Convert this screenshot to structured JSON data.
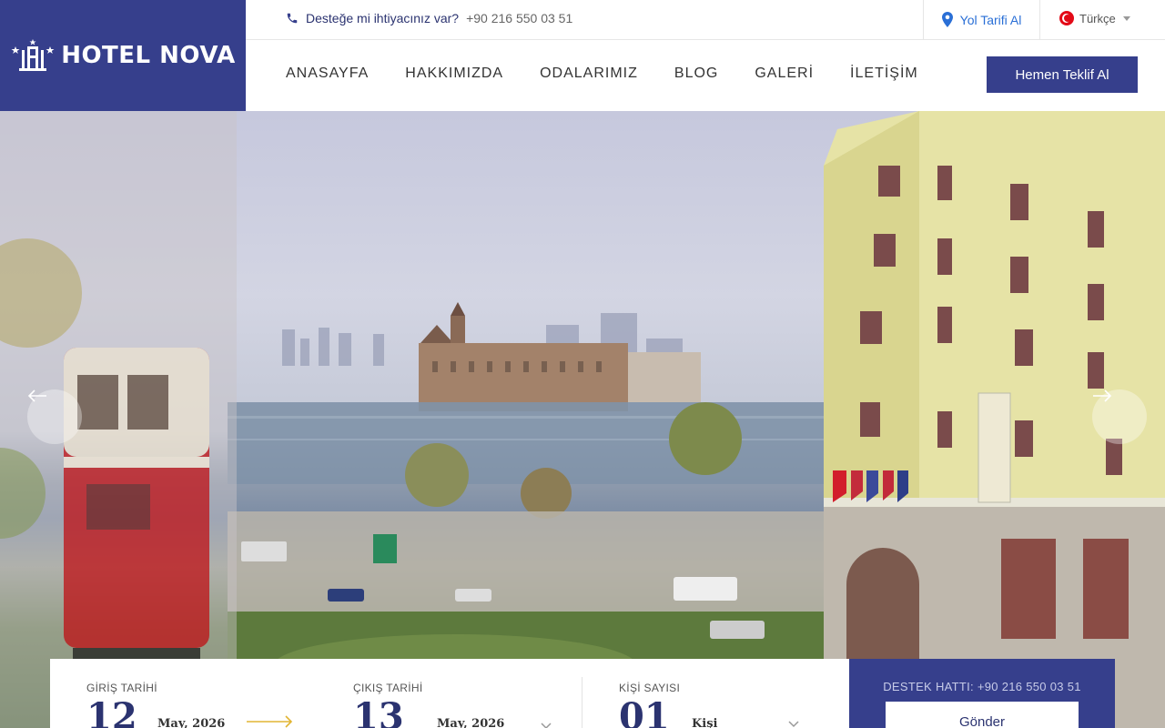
{
  "brand": {
    "name": "HOTEL NOVA",
    "color": "#363f8c"
  },
  "topbar": {
    "support_question": "Desteğe mi ihtiyacınız var?",
    "support_phone": "+90 216 550 03 51",
    "route_label": "Yol Tarifi Al",
    "language": "Türkçe"
  },
  "nav": {
    "items": [
      "ANASAYFA",
      "HAKKIMIZDA",
      "ODALARIMIZ",
      "BLOG",
      "GALERİ",
      "İLETİŞİM"
    ],
    "cta": "Hemen Teklif Al"
  },
  "hero": {
    "prev_icon": "arrow-left-icon",
    "next_icon": "arrow-right-icon"
  },
  "booking": {
    "checkin_label": "GİRİŞ TARİHİ",
    "checkin_day": "12",
    "checkin_month": "May, 2026",
    "checkout_label": "ÇIKIŞ TARİHİ",
    "checkout_day": "13",
    "checkout_month": "May, 2026",
    "guests_label": "KİŞİ SAYISI",
    "guests_count": "01",
    "guests_unit": "Kişi"
  },
  "support_panel": {
    "hotline": "DESTEK HATTI: +90 216 550 03 51",
    "send": "Gönder"
  }
}
